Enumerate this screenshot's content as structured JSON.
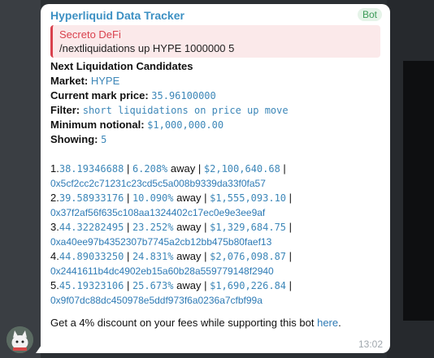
{
  "message": {
    "sender": "Hyperliquid Data Tracker",
    "badge": "Bot",
    "time": "13:02",
    "reply": {
      "name": "Secreto DeFi",
      "text": "/nextliquidations up HYPE 1000000 5"
    },
    "heading": "Next Liquidation Candidates",
    "fields": {
      "market_label": "Market:",
      "market_value": "HYPE",
      "price_label": "Current mark price:",
      "price_value": "35.96100000",
      "filter_label": "Filter:",
      "filter_value": "short liquidations on price up move",
      "notional_label": "Minimum notional:",
      "notional_value": "$1,000,000.00",
      "showing_label": "Showing:",
      "showing_value": "5"
    },
    "candidates": [
      {
        "index": "1.",
        "price": "38.19346688",
        "away": "6.208%",
        "notional": "$2,100,640.68",
        "address": "0x5cf2cc2c71231c23cd5c5a008b9339da33f0fa57"
      },
      {
        "index": "2.",
        "price": "39.58933176",
        "away": "10.090%",
        "notional": "$1,555,093.10",
        "address": "0x37f2af56f635c108aa1324402c17ec0e9e3ee9af"
      },
      {
        "index": "3.",
        "price": "44.32282495",
        "away": "23.252%",
        "notional": "$1,329,684.75",
        "address": "0xa40ee97b4352307b7745a2cb12bb475b80faef13"
      },
      {
        "index": "4.",
        "price": "44.89033250",
        "away": "24.831%",
        "notional": "$2,076,098.87",
        "address": "0x2441611b4dc4902eb15a60b28a559779148f2940"
      },
      {
        "index": "5.",
        "price": "45.19323106",
        "away": "25.673%",
        "notional": "$1,690,226.84",
        "address": "0x9f07dc88dc450978e5ddf973f6a0236a7cfbf99a"
      }
    ],
    "separator": " | ",
    "away_word": "away",
    "footer_text": "Get a 4% discount on your fees while supporting this bot",
    "footer_link": "here",
    "footer_end": "."
  }
}
